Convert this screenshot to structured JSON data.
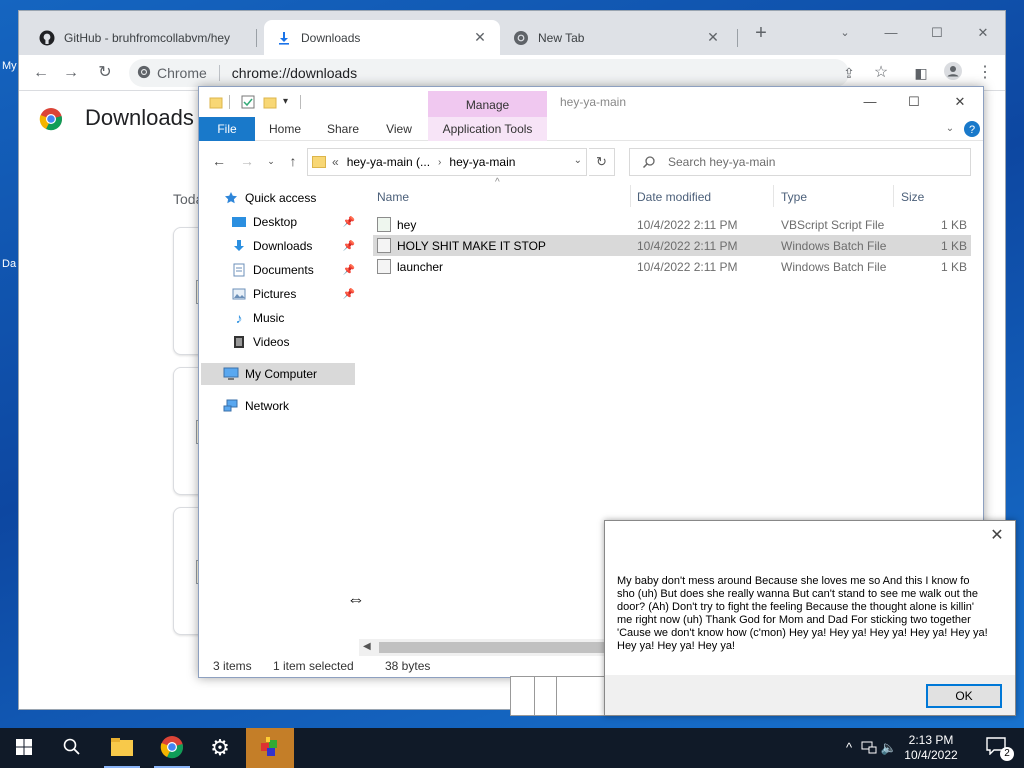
{
  "desktop": {
    "icon_label_1": "My",
    "icon_label_2": "Da"
  },
  "chrome": {
    "tabs": [
      {
        "label": "GitHub - bruhfromcollabvm/hey",
        "icon": "github-icon"
      },
      {
        "label": "Downloads",
        "icon": "download-icon"
      },
      {
        "label": "New Tab",
        "icon": "chrome-icon"
      }
    ],
    "omnibox": {
      "chip": "Chrome",
      "url": "chrome://downloads"
    },
    "page": {
      "title": "Downloads",
      "section_label": "Toda"
    }
  },
  "explorer": {
    "window_title": "hey-ya-main",
    "contextual_tab_group": "Manage",
    "ribbon_tabs": [
      "File",
      "Home",
      "Share",
      "View",
      "Application Tools"
    ],
    "address": {
      "overflow": "«",
      "crumb1": "hey-ya-main (...",
      "crumb2": "hey-ya-main"
    },
    "search_placeholder": "Search hey-ya-main",
    "nav": [
      {
        "label": "Quick access",
        "icon": "star-icon"
      },
      {
        "label": "Desktop",
        "icon": "desktop-icon",
        "pinned": true
      },
      {
        "label": "Downloads",
        "icon": "download-icon",
        "pinned": true
      },
      {
        "label": "Documents",
        "icon": "document-icon",
        "pinned": true
      },
      {
        "label": "Pictures",
        "icon": "picture-icon",
        "pinned": true
      },
      {
        "label": "Music",
        "icon": "music-icon"
      },
      {
        "label": "Videos",
        "icon": "video-icon"
      },
      {
        "label": "My Computer",
        "icon": "computer-icon",
        "selected": true
      },
      {
        "label": "Network",
        "icon": "network-icon"
      }
    ],
    "columns": [
      "Name",
      "Date modified",
      "Type",
      "Size"
    ],
    "files": [
      {
        "name": "hey",
        "date": "10/4/2022 2:11 PM",
        "type": "VBScript Script File",
        "size": "1 KB"
      },
      {
        "name": "HOLY SHIT MAKE IT STOP",
        "date": "10/4/2022 2:11 PM",
        "type": "Windows Batch File",
        "size": "1 KB",
        "selected": true
      },
      {
        "name": "launcher",
        "date": "10/4/2022 2:11 PM",
        "type": "Windows Batch File",
        "size": "1 KB"
      }
    ],
    "status": {
      "items": "3 items",
      "selected": "1 item selected",
      "size": "38 bytes"
    }
  },
  "message_box": {
    "text": "My baby don't mess around Because she loves me so And this I know fo sho (uh) But does she really wanna But can't stand to see me walk out the door? (Ah) Don't try to fight the feeling Because the thought alone is killin' me right now (uh) Thank God for Mom and Dad For sticking two together 'Cause we don't know how (c'mon) Hey ya! Hey ya! Hey ya! Hey ya! Hey ya! Hey ya! Hey ya! Hey ya!",
    "ok_label": "OK"
  },
  "taskbar": {
    "clock_time": "2:13 PM",
    "clock_date": "10/4/2022",
    "notification_count": "2"
  },
  "colors": {
    "accent": "#1979ca",
    "manage_tab": "#f0c8f0",
    "taskbar": "#101a28",
    "active_task": "#c47e28"
  }
}
